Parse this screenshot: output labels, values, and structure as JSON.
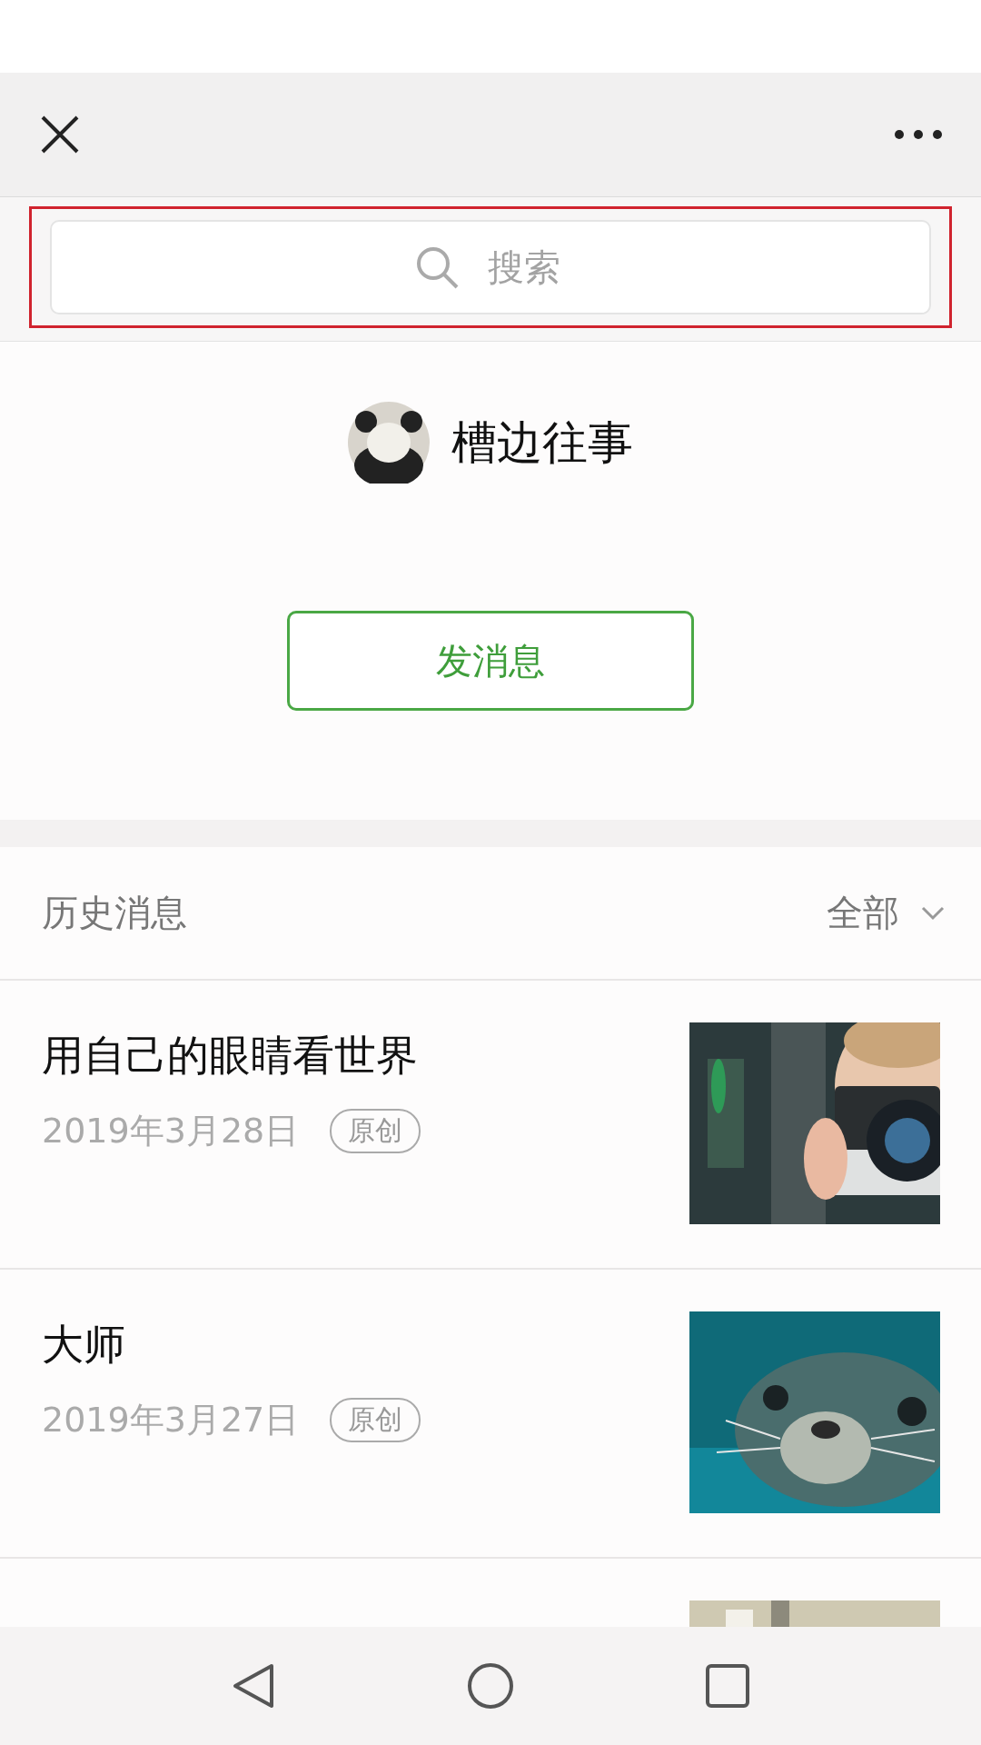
{
  "search": {
    "placeholder": "搜索",
    "highlighted": true
  },
  "profile": {
    "name": "槽边往事",
    "button": "发消息"
  },
  "history": {
    "title": "历史消息",
    "filter": "全部"
  },
  "articles": [
    {
      "title": "用自己的眼睛看世界",
      "date": "2019年3月28日",
      "badge": "原创",
      "kind": "picture"
    },
    {
      "title": "大师",
      "date": "2019年3月27日",
      "badge": "原创",
      "kind": "picture"
    },
    {
      "kind": "picture"
    }
  ]
}
